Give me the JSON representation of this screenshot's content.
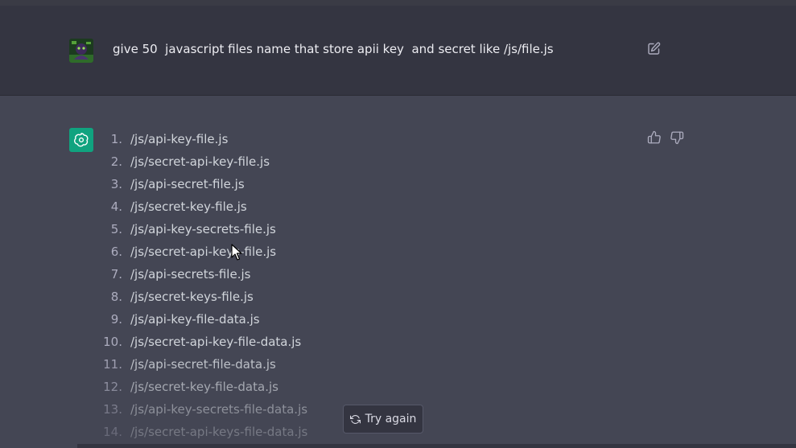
{
  "user_message": {
    "text": "give 50  javascript files name that store apii key  and secret like /js/file.js"
  },
  "assistant_message": {
    "items": [
      {
        "num": "1.",
        "text": "/js/api-key-file.js"
      },
      {
        "num": "2.",
        "text": "/js/secret-api-key-file.js"
      },
      {
        "num": "3.",
        "text": "/js/api-secret-file.js"
      },
      {
        "num": "4.",
        "text": "/js/secret-key-file.js"
      },
      {
        "num": "5.",
        "text": "/js/api-key-secrets-file.js"
      },
      {
        "num": "6.",
        "text": "/js/secret-api-keys-file.js"
      },
      {
        "num": "7.",
        "text": "/js/api-secrets-file.js"
      },
      {
        "num": "8.",
        "text": "/js/secret-keys-file.js"
      },
      {
        "num": "9.",
        "text": "/js/api-key-file-data.js"
      },
      {
        "num": "10.",
        "text": "/js/secret-api-key-file-data.js"
      },
      {
        "num": "11.",
        "text": "/js/api-secret-file-data.js"
      },
      {
        "num": "12.",
        "text": "/js/secret-key-file-data.js"
      },
      {
        "num": "13.",
        "text": "/js/api-key-secrets-file-data.js"
      },
      {
        "num": "14.",
        "text": "/js/secret-api-keys-file-data.js"
      }
    ]
  },
  "controls": {
    "try_again_label": "Try again",
    "edit_icon": "edit-icon",
    "thumbs_up_icon": "thumbs-up-icon",
    "thumbs_down_icon": "thumbs-down-icon",
    "refresh_icon": "refresh-icon"
  },
  "colors": {
    "user_bg": "#343541",
    "assistant_bg": "#444654",
    "accent": "#10a37f"
  }
}
